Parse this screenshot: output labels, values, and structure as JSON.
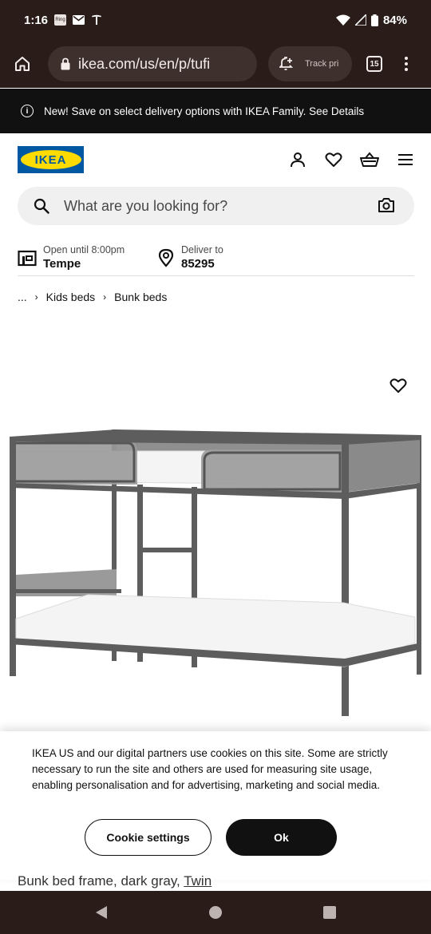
{
  "status_bar": {
    "time": "1:16",
    "battery": "84%",
    "notification_badge": "Ring"
  },
  "browser": {
    "url": "ikea.com/us/en/p/tufi",
    "track_label": "Track pri",
    "tab_count": "15"
  },
  "promo": {
    "text": "New! Save on select delivery options with IKEA Family. See Details"
  },
  "header": {
    "logo_text": "IKEA",
    "search_placeholder": "What are you looking for?"
  },
  "store": {
    "hours_label": "Open until 8:00pm",
    "store_name": "Tempe",
    "deliver_label": "Deliver to",
    "zip": "85295"
  },
  "breadcrumb": {
    "ellipsis": "...",
    "items": [
      "Kids beds",
      "Bunk beds"
    ]
  },
  "cookie": {
    "text": "IKEA US and our digital partners use cookies on this site. Some are strictly necessary to run the site and others are used for measuring site usage, enabling personalisation and for advertising, marketing and social media.",
    "settings_label": "Cookie settings",
    "ok_label": "Ok"
  },
  "product": {
    "title_prefix": "Bunk bed frame, dark gray, ",
    "size_link": "Twin"
  },
  "colors": {
    "system_bar": "#2a1d19",
    "ikea_blue": "#0058a3",
    "ikea_yellow": "#ffdb00",
    "bed_frame": "#606060",
    "mattress": "#f4f4f4"
  }
}
